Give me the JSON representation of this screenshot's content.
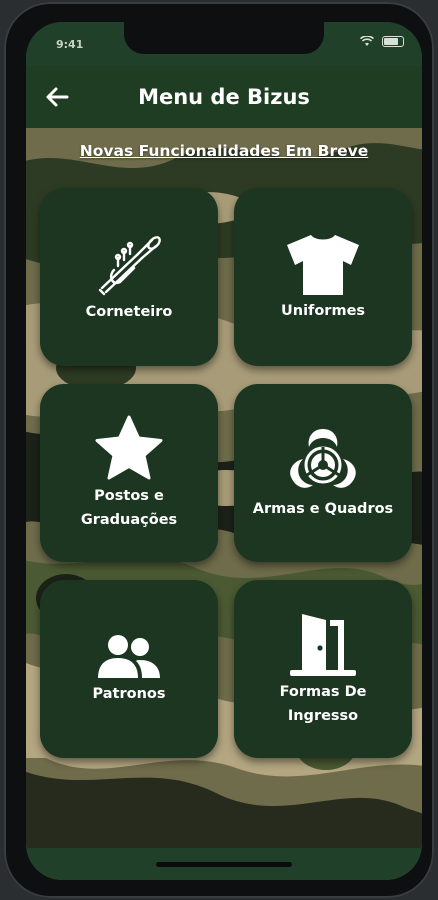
{
  "status_bar": {
    "time": "9:41"
  },
  "app_bar": {
    "title": "Menu de Bizus",
    "back_icon": "arrow-left-icon"
  },
  "notice": "Novas Funcionalidades Em Breve",
  "menu": [
    {
      "label": "Corneteiro",
      "icon": "trumpet-icon"
    },
    {
      "label": "Uniformes",
      "icon": "shirt-icon"
    },
    {
      "label": "Postos e Graduações",
      "icon": "star-icon"
    },
    {
      "label": "Armas e Quadros",
      "icon": "biohazard-icon"
    },
    {
      "label": "Patronos",
      "icon": "users-icon"
    },
    {
      "label": "Formas De Ingresso",
      "icon": "door-open-icon"
    }
  ],
  "colors": {
    "app_bar": "#1f3d22",
    "card": "#1c3621",
    "text": "#ffffff"
  }
}
